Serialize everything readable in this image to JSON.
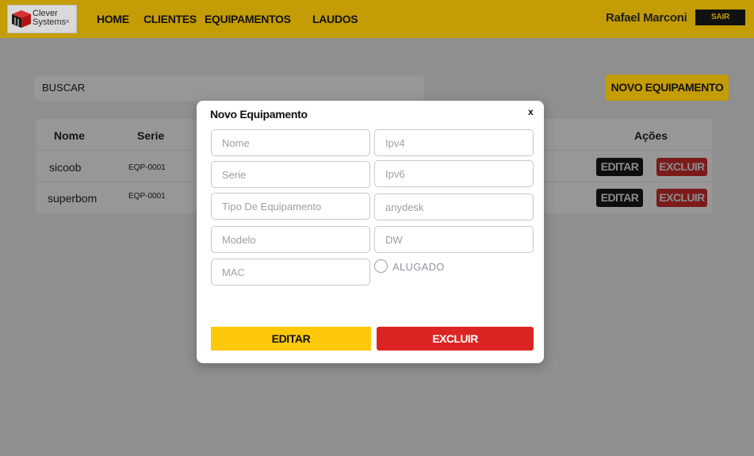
{
  "brand": {
    "logo_line1": "Clever",
    "logo_line2": "Systems",
    "logo_mark": "®"
  },
  "nav": {
    "items": [
      "HOME",
      "CLIENTES",
      "EQUIPAMENTOS",
      "LAUDOS"
    ]
  },
  "user": {
    "name": "Rafael Marconi",
    "logout_label": "SAIR"
  },
  "search": {
    "label": "BUSCAR"
  },
  "actions": {
    "new_equipment_label": "NOVO EQUIPAMENTO"
  },
  "table": {
    "columns": [
      "Nome",
      "Serie",
      "Ações"
    ],
    "rows": [
      {
        "nome": "sicoob",
        "serie": "EQP-0001",
        "edit_label": "EDITAR",
        "delete_label": "EXCLUIR"
      },
      {
        "nome": "superbom",
        "serie": "EQP-0001",
        "edit_label": "EDITAR",
        "delete_label": "EXCLUIR"
      }
    ]
  },
  "modal": {
    "title": "Novo Equipamento",
    "close_label": "x",
    "fields": {
      "nome_placeholder": "Nome",
      "serie_placeholder": "Serie",
      "tipo_placeholder": "Tipo De Equipamento",
      "modelo_placeholder": "Modelo",
      "mac_placeholder": "MAC",
      "ipv4_placeholder": "Ipv4",
      "ipv6_placeholder": "Ipv6",
      "anydesk_placeholder": "anydesk",
      "dw_placeholder": "DW"
    },
    "alugado_label": "ALUGADO",
    "alugado_checked": false,
    "edit_label": "EDITAR",
    "delete_label": "EXCLUIR"
  },
  "colors": {
    "brand_yellow": "#fdc80a",
    "danger_red": "#dd2424",
    "overlay": "#8f8f8f"
  }
}
